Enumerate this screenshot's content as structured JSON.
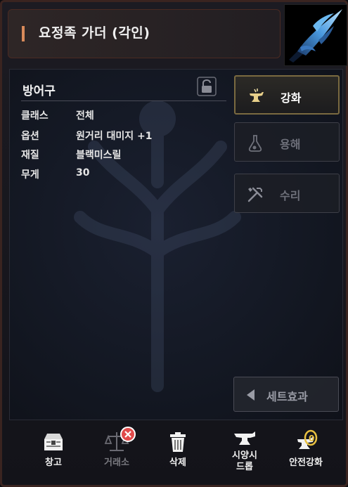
{
  "title": "요정족 가더 (각인)",
  "item": {
    "category": "방어구",
    "stats": [
      {
        "label": "클래스",
        "value": "전체"
      },
      {
        "label": "옵션",
        "value": "원거리 대미지 +1"
      },
      {
        "label": "재질",
        "value": "블랙미스릴"
      },
      {
        "label": "무게",
        "value": "30"
      }
    ]
  },
  "side_buttons": {
    "enchant": "강화",
    "dissolve": "용해",
    "repair": "수리",
    "set_effect": "세트효과"
  },
  "bottom_buttons": {
    "warehouse": "창고",
    "exchange": "거래소",
    "delete": "삭제",
    "simulate_drop": "시양시\n드롭",
    "safe_enchant": "안전강화"
  },
  "colors": {
    "accent": "#d88a5a",
    "active_border": "#7a6a40",
    "badge_red": "#e04a4a"
  }
}
